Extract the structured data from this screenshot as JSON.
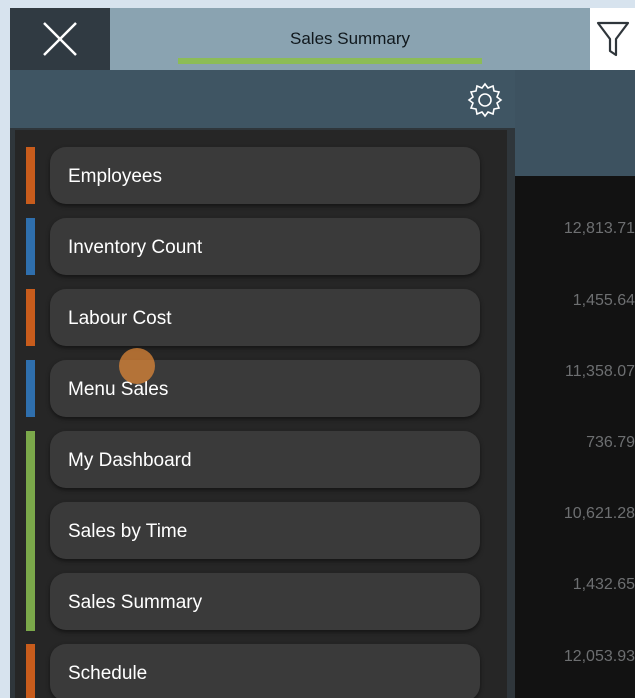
{
  "header": {
    "title": "Sales Summary",
    "accent": "#8cbc57"
  },
  "icons": {
    "close": "close-icon",
    "filter": "filter-icon",
    "settings": "gear-icon"
  },
  "colors": {
    "orange": "#c85c1c",
    "blue": "#2f6fad",
    "green": "#7ba84a"
  },
  "menu": {
    "items": [
      {
        "label": "Employees"
      },
      {
        "label": "Inventory Count"
      },
      {
        "label": "Labour Cost"
      },
      {
        "label": "Menu Sales"
      },
      {
        "label": "My Dashboard"
      },
      {
        "label": "Sales by Time"
      },
      {
        "label": "Sales Summary"
      },
      {
        "label": "Schedule"
      }
    ]
  },
  "data": {
    "values": [
      "12,813.71",
      "1,455.64",
      "11,358.07",
      "736.79",
      "10,621.28",
      "1,432.65",
      "12,053.93"
    ]
  }
}
